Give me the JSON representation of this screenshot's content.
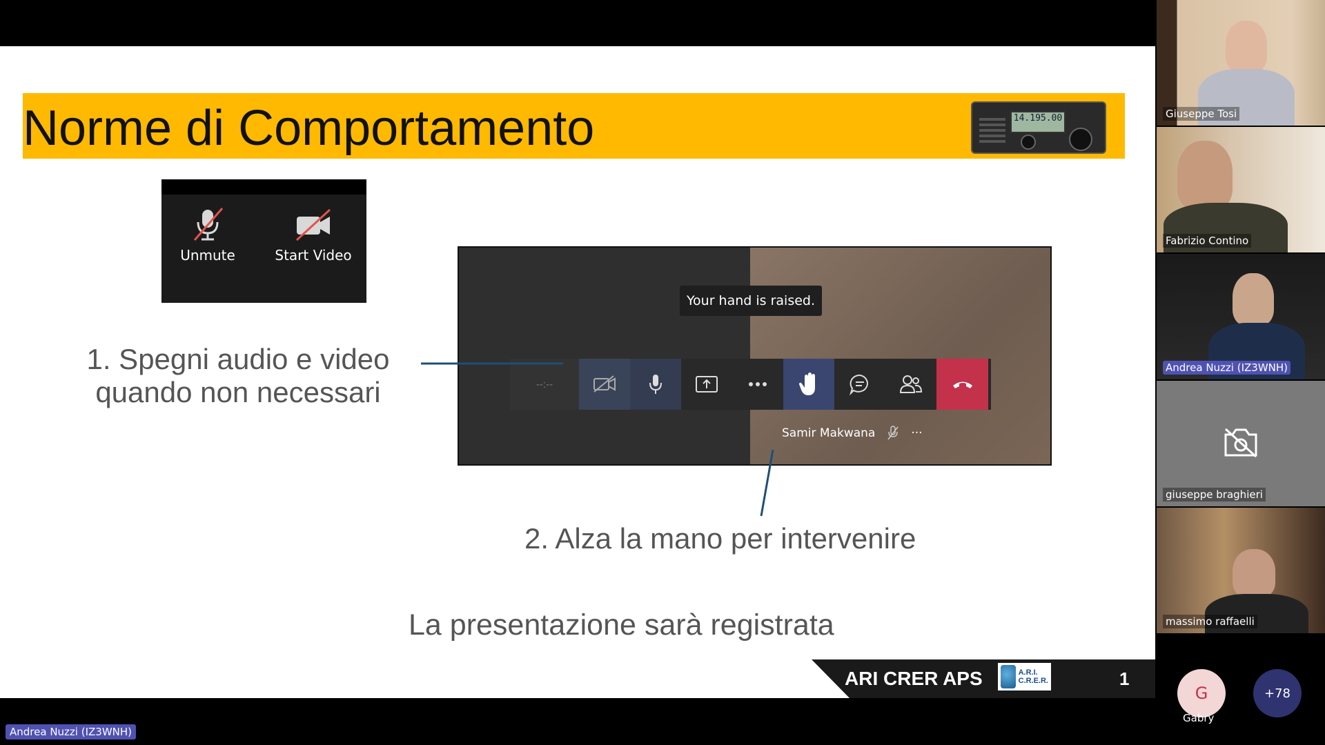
{
  "slide": {
    "title": "Norme di Comportamento",
    "radio_display": "14.195.00",
    "zoom_controls": {
      "unmute_label": "Unmute",
      "start_video_label": "Start Video"
    },
    "teams_preview": {
      "raised_tooltip": "Your hand is raised.",
      "timer_text": "--:--",
      "participant_name": "Samir Makwana",
      "more_text": "···"
    },
    "step1": {
      "line1": "1. Spegni audio e video",
      "line2": "quando non necessari"
    },
    "step2": "2. Alza la mano per intervenire",
    "recorded_note": "La presentazione sarà registrata",
    "footer": {
      "org": "ARI CRER APS",
      "logo_line1": "A.R.I.",
      "logo_line2": "C.R.E.R.",
      "page_number": "1"
    }
  },
  "participants": [
    {
      "name": "Giuseppe Tosi",
      "highlighted": false
    },
    {
      "name": "Fabrizio Contino",
      "highlighted": false
    },
    {
      "name": "Andrea Nuzzi (IZ3WNH)",
      "highlighted": true
    },
    {
      "name": "giuseppe braghieri",
      "highlighted": false,
      "camera_off": true
    },
    {
      "name": "massimo raffaelli",
      "highlighted": false
    }
  ],
  "extra_participants": {
    "avatar_initial": "G",
    "avatar_name": "Gabry",
    "more_count": "+78"
  },
  "active_speaker_label": "Andrea Nuzzi (IZ3WNH)",
  "colors": {
    "title_bar": "#ffb900",
    "teams_accent": "#4f52b2",
    "hangup": "#c4314b"
  }
}
